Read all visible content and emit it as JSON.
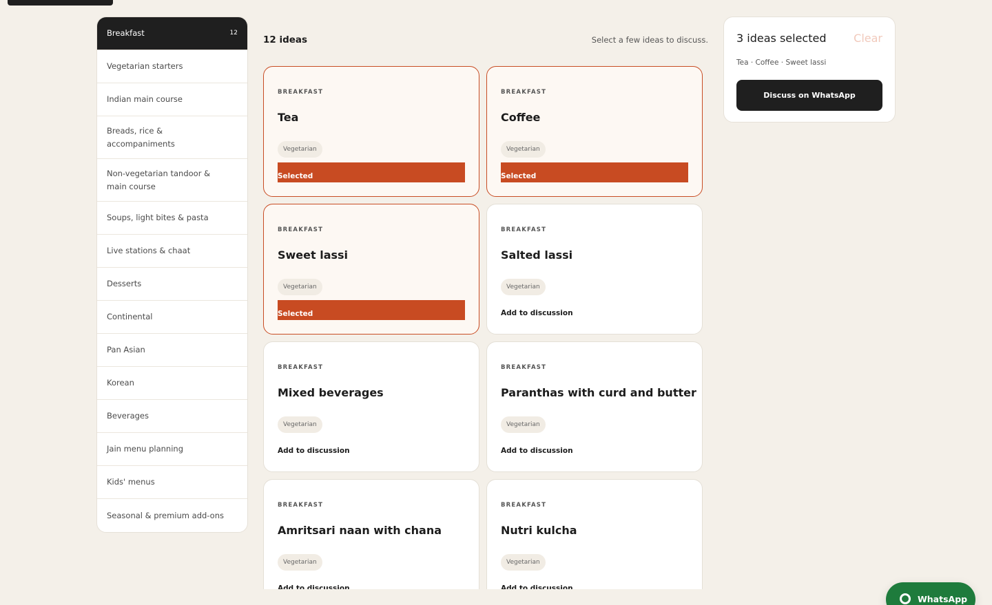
{
  "sidebar": {
    "items": [
      {
        "label": "Breakfast",
        "count": "12",
        "active": true
      },
      {
        "label": "Vegetarian starters"
      },
      {
        "label": "Indian main course"
      },
      {
        "label": "Breads, rice & accompaniments"
      },
      {
        "label": "Non-vegetarian tandoor & main course"
      },
      {
        "label": "Soups, light bites & pasta"
      },
      {
        "label": "Live stations & chaat"
      },
      {
        "label": "Desserts"
      },
      {
        "label": "Continental"
      },
      {
        "label": "Pan Asian"
      },
      {
        "label": "Korean"
      },
      {
        "label": "Beverages"
      },
      {
        "label": "Jain menu planning"
      },
      {
        "label": "Kids' menus"
      },
      {
        "label": "Seasonal & premium add-ons"
      }
    ]
  },
  "main": {
    "ideas_count": "12 ideas",
    "hint": "Select a few ideas to discuss.",
    "cards": [
      {
        "category": "BREAKFAST",
        "title": "Tea",
        "tag": "Vegetarian",
        "selected": true
      },
      {
        "category": "BREAKFAST",
        "title": "Coffee",
        "tag": "Vegetarian",
        "selected": true
      },
      {
        "category": "BREAKFAST",
        "title": "Sweet lassi",
        "tag": "Vegetarian",
        "selected": true
      },
      {
        "category": "BREAKFAST",
        "title": "Salted lassi",
        "tag": "Vegetarian",
        "selected": false
      },
      {
        "category": "BREAKFAST",
        "title": "Mixed beverages",
        "tag": "Vegetarian",
        "selected": false
      },
      {
        "category": "BREAKFAST",
        "title": "Paranthas with curd and butter",
        "tag": "Vegetarian",
        "selected": false
      },
      {
        "category": "BREAKFAST",
        "title": "Amritsari naan with chana",
        "tag": "Vegetarian",
        "selected": false
      },
      {
        "category": "BREAKFAST",
        "title": "Nutri kulcha",
        "tag": "Vegetarian",
        "selected": false
      }
    ],
    "selected_label": "Selected",
    "add_label": "Add to discussion"
  },
  "summary": {
    "title": "3 ideas selected",
    "clear_label": "Clear",
    "list": "Tea · Coffee · Sweet lassi",
    "discuss_label": "Discuss on WhatsApp"
  },
  "fab": {
    "label": "WhatsApp",
    "icon": "whatsapp-icon"
  },
  "colors": {
    "accent": "#c84b22",
    "dark": "#1f1f1f",
    "background": "#f4f0e9",
    "whatsapp": "#1e7b3c"
  }
}
